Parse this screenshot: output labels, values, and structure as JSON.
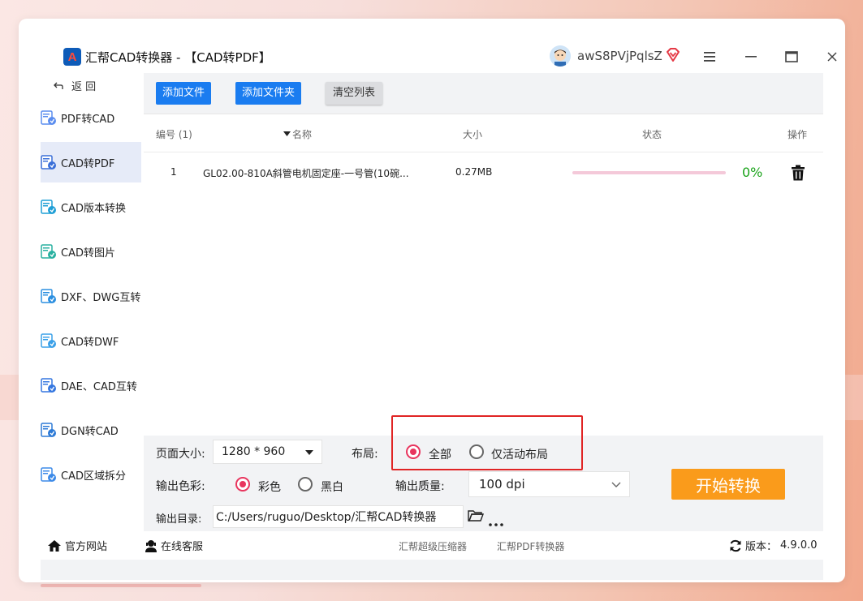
{
  "app": {
    "title": "汇帮CAD转换器 - 【CAD转PDF】",
    "logo_letter": "A",
    "username": "awS8PVjPqlsZ"
  },
  "sidebar": {
    "back_label": "返 回",
    "items": [
      {
        "label": "PDF转CAD",
        "icon": "pdf-to-cad-icon"
      },
      {
        "label": "CAD转PDF",
        "icon": "cad-to-pdf-icon",
        "active": true
      },
      {
        "label": "CAD版本转换",
        "icon": "cad-version-icon"
      },
      {
        "label": "CAD转图片",
        "icon": "cad-to-image-icon"
      },
      {
        "label": "DXF、DWG互转",
        "icon": "dxf-dwg-icon"
      },
      {
        "label": "CAD转DWF",
        "icon": "cad-to-dwf-icon"
      },
      {
        "label": "DAE、CAD互转",
        "icon": "dae-cad-icon"
      },
      {
        "label": "DGN转CAD",
        "icon": "dgn-to-cad-icon"
      },
      {
        "label": "CAD区域拆分",
        "icon": "cad-split-icon"
      }
    ]
  },
  "toolbar": {
    "add_file": "添加文件",
    "add_folder": "添加文件夹",
    "clear_list": "清空列表"
  },
  "table": {
    "headers": {
      "index": "编号 (1)",
      "name": "名称",
      "size": "大小",
      "status": "状态",
      "action": "操作"
    },
    "rows": [
      {
        "index": "1",
        "name": "GL02.00-810A斜管电机固定座-一号管(10碗...",
        "size": "0.27MB",
        "progress": 0,
        "percent": "0%"
      }
    ]
  },
  "settings": {
    "page_size_label": "页面大小:",
    "page_size_value": "1280 * 960",
    "layout_label": "布局:",
    "layout_all": "全部",
    "layout_active": "仅活动布局",
    "color_label": "输出色彩:",
    "color_color": "彩色",
    "color_bw": "黑白",
    "quality_label": "输出质量:",
    "quality_value": "100 dpi",
    "output_dir_label": "输出目录:",
    "output_dir_value": "C:/Users/ruguo/Desktop/汇帮CAD转换器",
    "start_button": "开始转换"
  },
  "footer": {
    "website": "官方网站",
    "support": "在线客服",
    "compressor": "汇帮超级压缩器",
    "pdf_converter": "汇帮PDF转换器",
    "version_label": "版本：",
    "version": "4.9.0.0"
  },
  "colors": {
    "accent_blue": "#1a7cf0",
    "start_orange": "#fa9b1b",
    "radio_pink": "#e8355e",
    "progress_green": "#1aa31a",
    "highlight_red": "#e02424"
  }
}
